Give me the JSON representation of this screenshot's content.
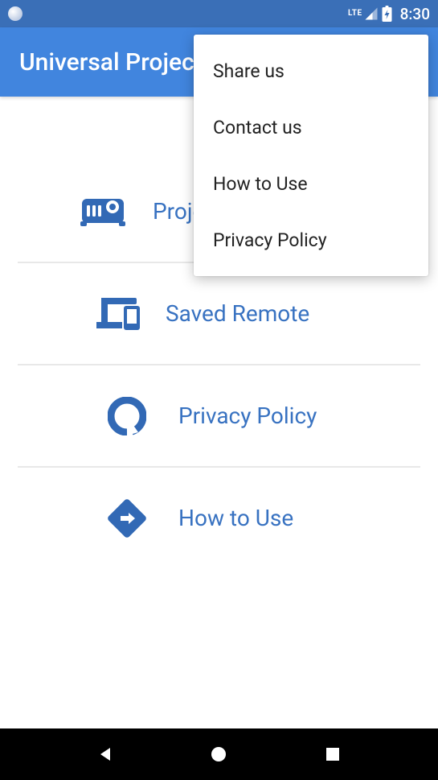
{
  "status": {
    "network": "LTE",
    "time": "8:30"
  },
  "appbar": {
    "title": "Universal Projec"
  },
  "colors": {
    "primary": "#4185de",
    "primaryDark": "#3a6fb7",
    "link": "#3872c1",
    "iconBlue": "#3269b5"
  },
  "menu": {
    "items": [
      {
        "label": "Projector",
        "icon": "projector-icon"
      },
      {
        "label": "Saved Remote",
        "icon": "devices-icon"
      },
      {
        "label": "Privacy Policy",
        "icon": "ring-icon"
      },
      {
        "label": "How to Use",
        "icon": "directions-icon"
      }
    ]
  },
  "overflow": {
    "items": [
      {
        "label": "Share us"
      },
      {
        "label": "Contact us"
      },
      {
        "label": "How to Use"
      },
      {
        "label": "Privacy Policy"
      }
    ]
  }
}
